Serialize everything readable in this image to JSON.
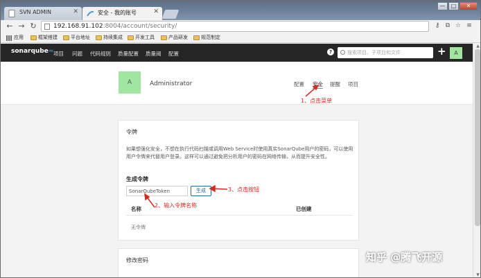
{
  "browser": {
    "tabs": [
      {
        "label": "SVN ADMIN"
      },
      {
        "label": "安全 - 我的账号"
      }
    ],
    "window_controls": [
      "—",
      "□",
      "✕"
    ],
    "url": {
      "host": "192.168.91.102",
      "rest": ":8004/account/security/"
    },
    "bookmarks": [
      {
        "label": "应用",
        "icon": "apps-grid-icon"
      },
      {
        "label": "框架搭建",
        "icon": "folder-icon"
      },
      {
        "label": "平台地址",
        "icon": "folder-icon"
      },
      {
        "label": "持续集成",
        "icon": "folder-icon"
      },
      {
        "label": "开发工具",
        "icon": "folder-icon"
      },
      {
        "label": "产品研发",
        "icon": "folder-icon"
      },
      {
        "label": "规范制定",
        "icon": "folder-icon"
      }
    ]
  },
  "sonar": {
    "logo": {
      "text": "sonarqube",
      "wave": "≈"
    },
    "nav": [
      "项目",
      "问题",
      "代码规则",
      "质量配置",
      "质量阈",
      "配置"
    ],
    "search_placeholder": "搜索项目、子项目和文件",
    "avatar_letter": "A",
    "help": "?",
    "plus": "+"
  },
  "account": {
    "avatar_letter": "A",
    "name": "Administrator",
    "tabs": [
      "配置",
      "安全",
      "提醒",
      "项目"
    ]
  },
  "tokens": {
    "title": "令牌",
    "description": "如果想强化安全，不想在执行代码扫描或调用Web Service时使用真实SonarQube用户的密码，可以使用用户令牌来代替用户登录。这样可以通过避免把分析用户的密码在网络传输，从而提升安全性。",
    "generate_title": "生成令牌",
    "token_input_value": "SonarQubeToken",
    "generate_button": "生成",
    "col_name": "名称",
    "col_created": "已创建",
    "empty_text": "无令牌"
  },
  "password": {
    "title": "修改密码"
  },
  "annotations": {
    "a1": "1、点击菜单",
    "a2": "2、输入令牌名称",
    "a3": "3、点击按钮",
    "color": "#d9281e"
  },
  "watermark": "知乎 @腾飞开源"
}
